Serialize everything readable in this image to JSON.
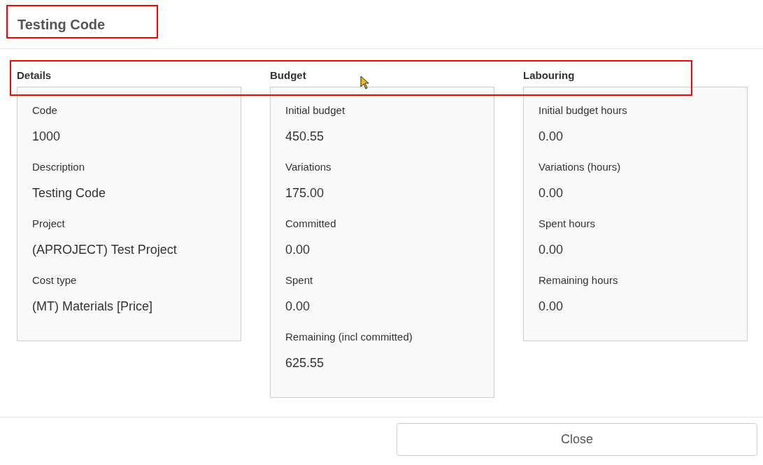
{
  "dialog": {
    "title": "Testing Code"
  },
  "sections": [
    {
      "title": "Details",
      "fields": [
        {
          "label": "Code",
          "value": "1000"
        },
        {
          "label": "Description",
          "value": "Testing Code"
        },
        {
          "label": "Project",
          "value": "(APROJECT) Test Project"
        },
        {
          "label": "Cost type",
          "value": "(MT) Materials [Price]"
        }
      ]
    },
    {
      "title": "Budget",
      "fields": [
        {
          "label": "Initial budget",
          "value": "450.55"
        },
        {
          "label": "Variations",
          "value": "175.00"
        },
        {
          "label": "Committed",
          "value": "0.00"
        },
        {
          "label": "Spent",
          "value": "0.00"
        },
        {
          "label": "Remaining (incl committed)",
          "value": "625.55"
        }
      ]
    },
    {
      "title": "Labouring",
      "fields": [
        {
          "label": "Initial budget hours",
          "value": "0.00"
        },
        {
          "label": "Variations (hours)",
          "value": "0.00"
        },
        {
          "label": "Spent hours",
          "value": "0.00"
        },
        {
          "label": "Remaining hours",
          "value": "0.00"
        }
      ]
    }
  ],
  "buttons": [
    "Close"
  ]
}
